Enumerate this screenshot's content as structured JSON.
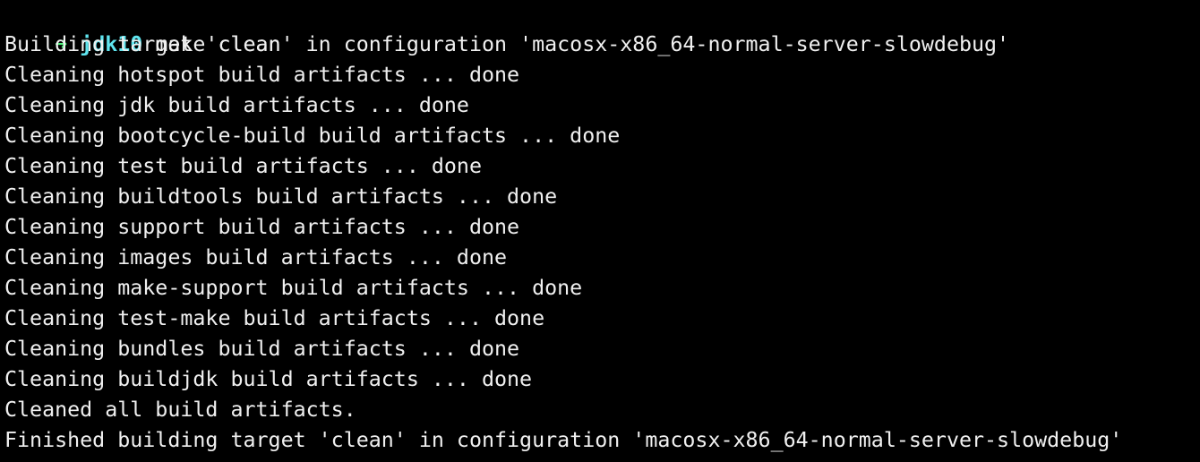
{
  "colors": {
    "background": "#000000",
    "text": "#f0f0f0",
    "prompt_arrow": "#4cf07a",
    "prompt_dir": "#5fe4ee"
  },
  "prompt": {
    "arrow_icon": "right-arrow-icon",
    "arrow": "➜",
    "directory": "jdk10",
    "command": "make clean"
  },
  "output": [
    "Building target 'clean' in configuration 'macosx-x86_64-normal-server-slowdebug'",
    "Cleaning hotspot build artifacts ... done",
    "Cleaning jdk build artifacts ... done",
    "Cleaning bootcycle-build build artifacts ... done",
    "Cleaning test build artifacts ... done",
    "Cleaning buildtools build artifacts ... done",
    "Cleaning support build artifacts ... done",
    "Cleaning images build artifacts ... done",
    "Cleaning make-support build artifacts ... done",
    "Cleaning test-make build artifacts ... done",
    "Cleaning bundles build artifacts ... done",
    "Cleaning buildjdk build artifacts ... done",
    "Cleaned all build artifacts.",
    "Finished building target 'clean' in configuration 'macosx-x86_64-normal-server-slowdebug'"
  ]
}
